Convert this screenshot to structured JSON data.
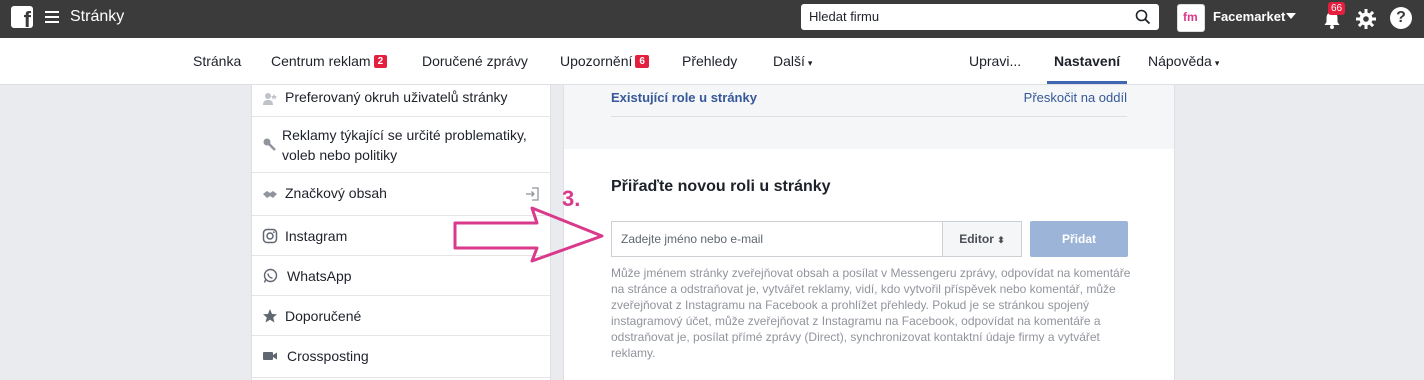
{
  "topbar": {
    "app_title": "Stránky",
    "search_placeholder": "Hledat firmu",
    "profile_name": "Facemarket",
    "avatar_text": "fm",
    "notification_count": "66",
    "help_label": "?"
  },
  "nav": {
    "items": [
      {
        "label": "Stránka"
      },
      {
        "label": "Centrum reklam",
        "badge": "2"
      },
      {
        "label": "Doručené zprávy"
      },
      {
        "label": "Upozornění",
        "badge": "6"
      },
      {
        "label": "Přehledy"
      },
      {
        "label": "Další"
      }
    ],
    "right_items": [
      {
        "label": "Upravi..."
      },
      {
        "label": "Nastavení"
      },
      {
        "label": "Nápověda"
      }
    ],
    "caret": "▾"
  },
  "sidebar": {
    "items": [
      {
        "label": "Preferovaný okruh uživatelů stránky",
        "icon": "audience-icon"
      },
      {
        "label": "Reklamy týkající se určité problematiky, voleb nebo politiky",
        "icon": "wrench-icon"
      },
      {
        "label": "Značkový obsah",
        "icon": "handshake-icon"
      },
      {
        "label": "Instagram",
        "icon": "instagram-icon"
      },
      {
        "label": "WhatsApp",
        "icon": "whatsapp-icon"
      },
      {
        "label": "Doporučené",
        "icon": "star-icon"
      },
      {
        "label": "Crossposting",
        "icon": "video-icon"
      }
    ]
  },
  "main": {
    "existing_role_title": "Existující role u stránky",
    "skip_link": "Přeskočit na oddíl",
    "assign_title": "Přiřaďte novou roli u stránky",
    "name_placeholder": "Zadejte jméno nebo e-mail",
    "role_value": "Editor",
    "role_caret": "⬍",
    "add_label": "Přidat",
    "role_description": "Může jménem stránky zveřejňovat obsah a posílat v Messengeru zprávy, odpovídat na komentáře na stránce a odstraňovat je, vytvářet reklamy, vidí, kdo vytvořil příspěvek nebo komentář, může zveřejňovat z Instagramu na Facebook a prohlížet přehledy. Pokud je se stránkou spojený instagramový účet, může zveřejňovat z Instagramu na Facebook, odpovídat na komentáře a odstraňovat je, posílat přímé zprávy (Direct), synchronizovat kontaktní údaje firmy a vytvářet reklamy."
  },
  "annotation": {
    "step": "3.",
    "color": "#d93a8c"
  }
}
